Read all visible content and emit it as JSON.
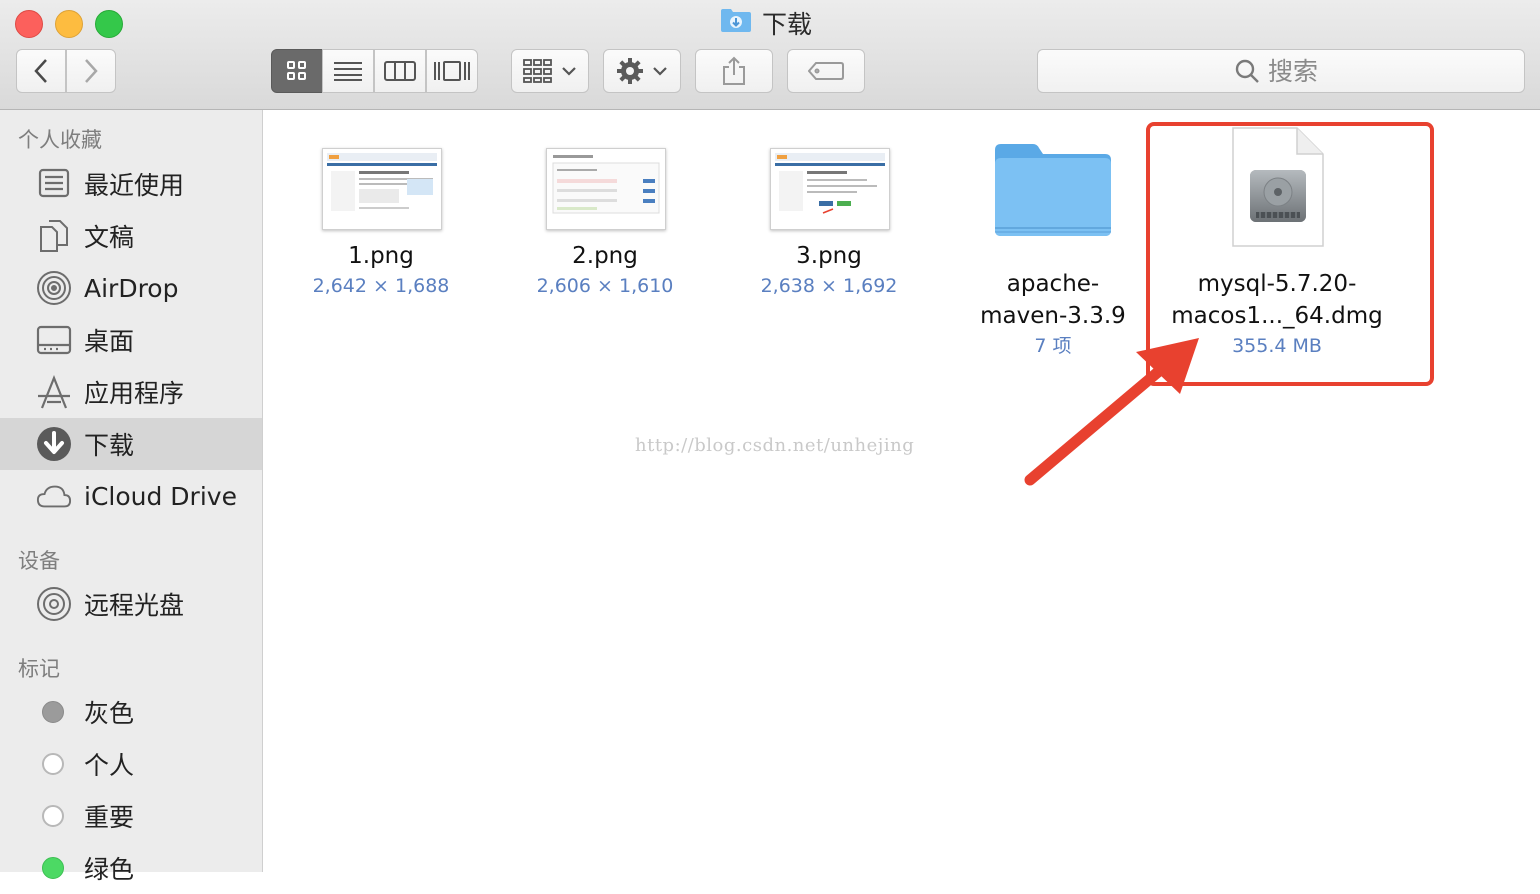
{
  "window": {
    "title": "下载"
  },
  "toolbar": {
    "back_icon": "chevron-left-icon",
    "forward_icon": "chevron-right-icon",
    "view_modes": [
      "icon-view",
      "list-view",
      "column-view",
      "cover-flow-view"
    ],
    "active_view": "icon-view",
    "arrange_icon": "grid-arrange-icon",
    "action_icon": "gear-icon",
    "share_icon": "share-icon",
    "tag_icon": "tag-icon",
    "search_placeholder": "搜索"
  },
  "sidebar": {
    "favorites_header": "个人收藏",
    "favorites": [
      {
        "label": "最近使用",
        "icon": "recents-icon"
      },
      {
        "label": "文稿",
        "icon": "documents-icon"
      },
      {
        "label": "AirDrop",
        "icon": "airdrop-icon"
      },
      {
        "label": "桌面",
        "icon": "desktop-icon"
      },
      {
        "label": "应用程序",
        "icon": "applications-icon"
      },
      {
        "label": "下载",
        "icon": "downloads-icon",
        "selected": true
      },
      {
        "label": "iCloud Drive",
        "icon": "icloud-icon"
      }
    ],
    "devices_header": "设备",
    "devices": [
      {
        "label": "远程光盘",
        "icon": "remote-disc-icon"
      }
    ],
    "tags_header": "标记",
    "tags": [
      {
        "label": "灰色",
        "color": "#9b9b9b"
      },
      {
        "label": "个人",
        "color": "#ffffff"
      },
      {
        "label": "重要",
        "color": "#ffffff"
      },
      {
        "label": "绿色",
        "color": "#4cd964"
      }
    ]
  },
  "files": [
    {
      "name": "1.png",
      "meta": "2,642 × 1,688",
      "kind": "image"
    },
    {
      "name": "2.png",
      "meta": "2,606 × 1,610",
      "kind": "image"
    },
    {
      "name": "3.png",
      "meta": "2,638 × 1,692",
      "kind": "image"
    },
    {
      "name_line1": "apache-",
      "name_line2": "maven-3.3.9",
      "meta": "7 项",
      "kind": "folder"
    },
    {
      "name_line1": "mysql-5.7.20-",
      "name_line2": "macos1..._64.dmg",
      "meta": "355.4 MB",
      "kind": "disk-image",
      "highlighted": true
    }
  ],
  "watermark": "http://blog.csdn.net/unhejing",
  "colors": {
    "annotation": "#e8412f",
    "meta_text": "#5a7fc0",
    "folder": "#6fb8ef"
  }
}
